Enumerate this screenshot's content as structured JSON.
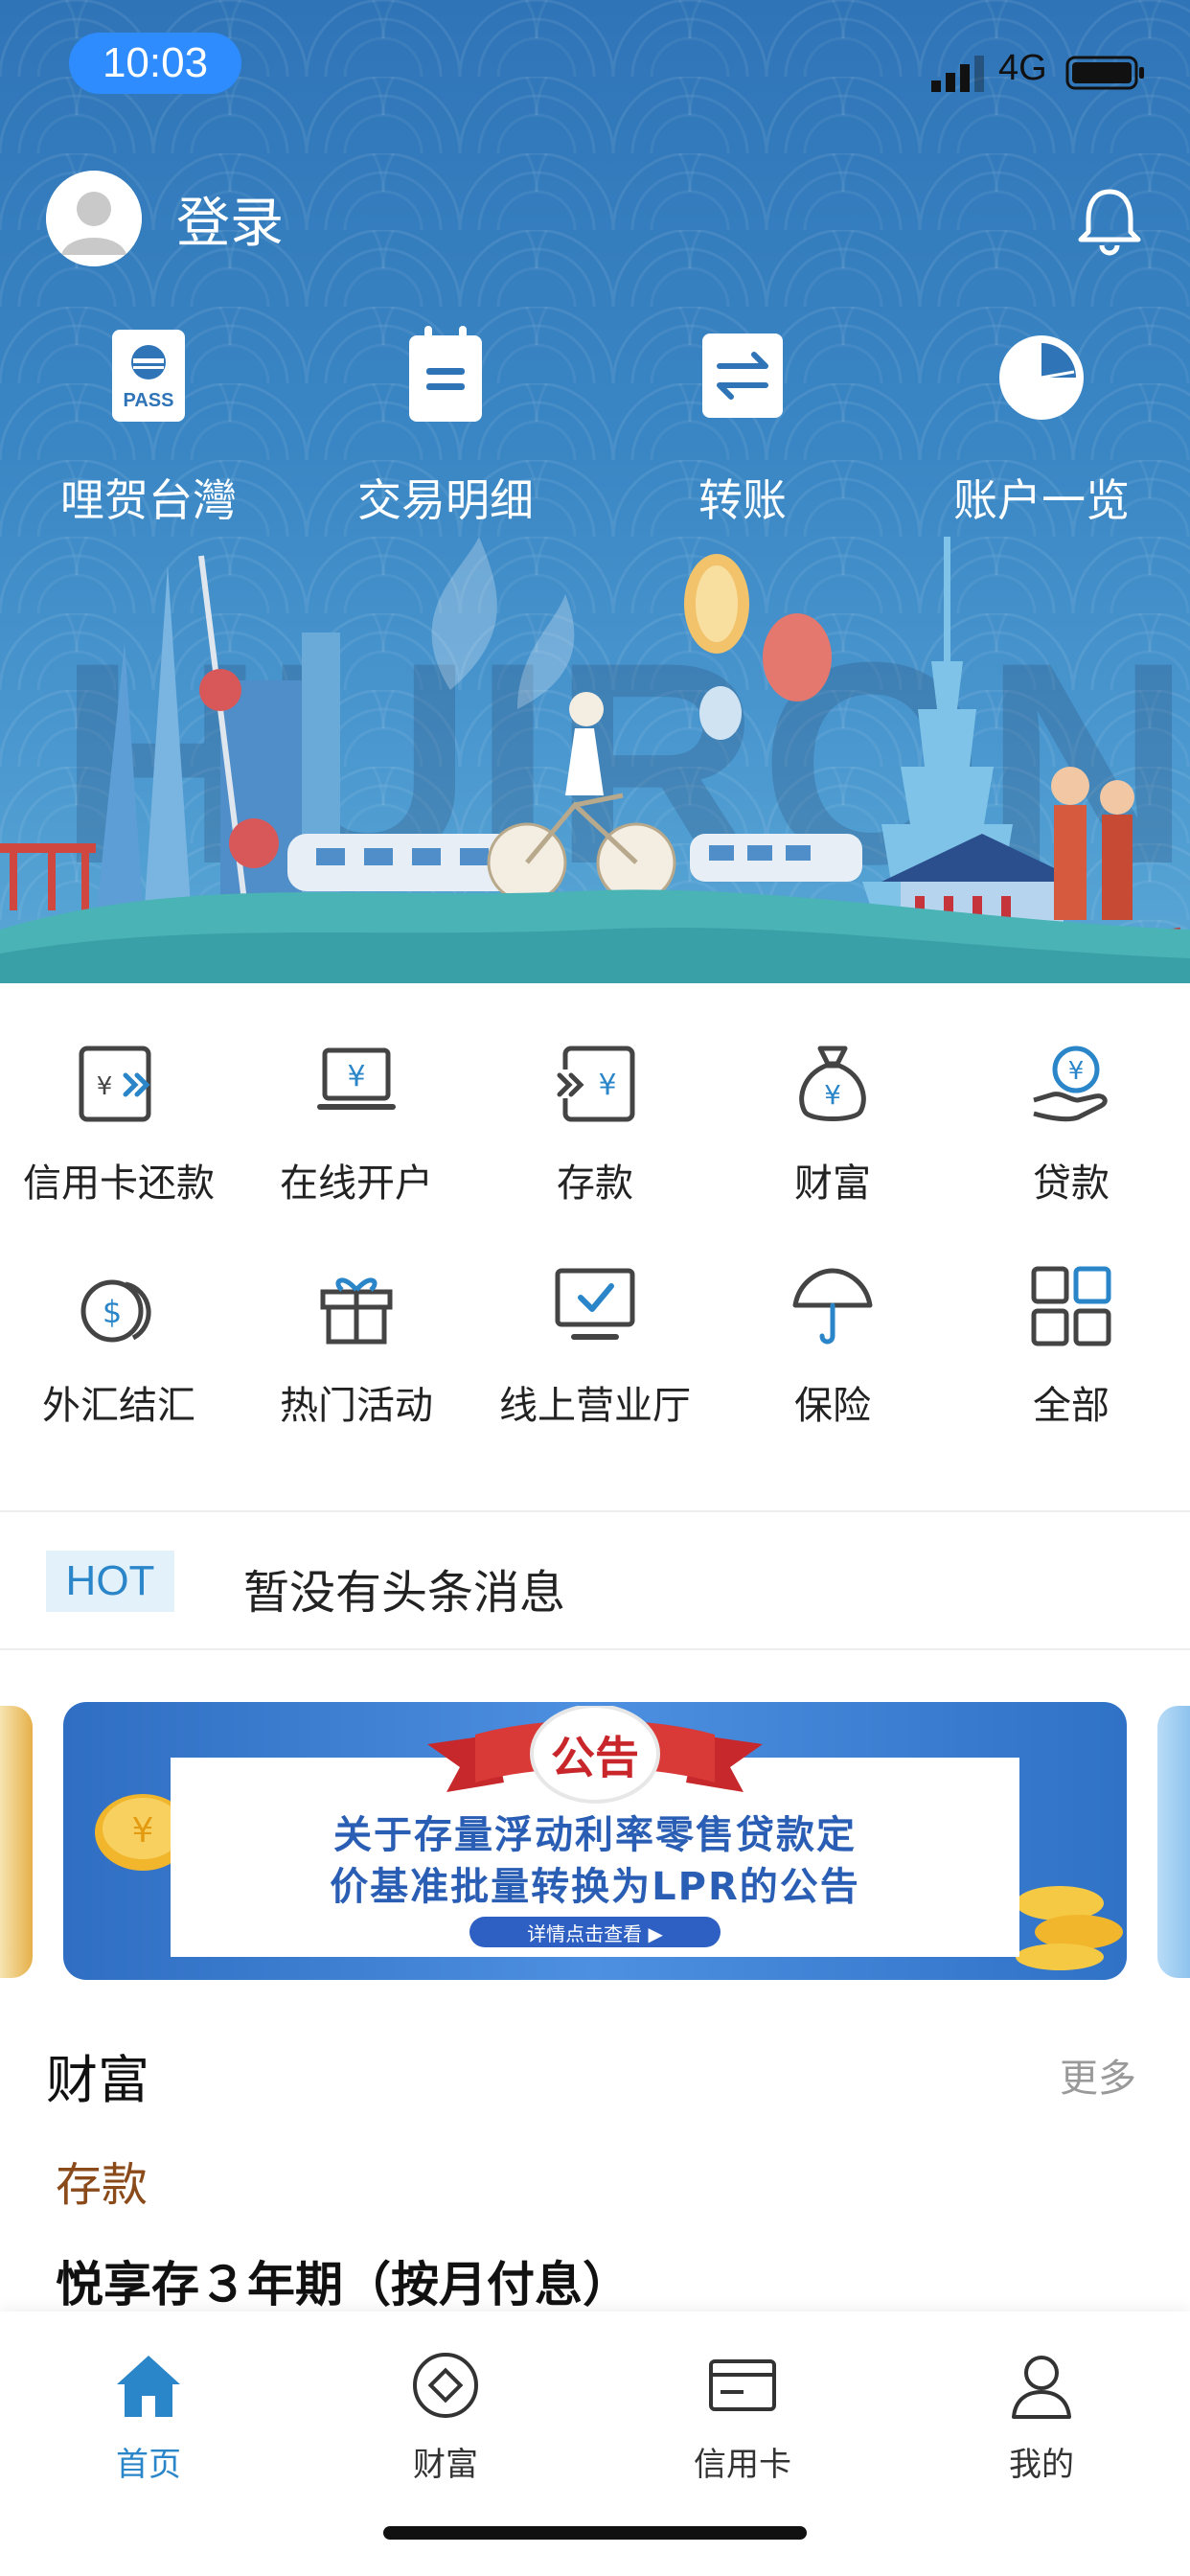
{
  "status_bar": {
    "time": "10:03",
    "network": "4G"
  },
  "header": {
    "login_label": "登录"
  },
  "quick_actions": [
    {
      "label": "哩贺台灣",
      "icon": "pass-icon"
    },
    {
      "label": "交易明细",
      "icon": "notepad-icon"
    },
    {
      "label": "转账",
      "icon": "transfer-icon"
    },
    {
      "label": "账户一览",
      "icon": "pie-chart-icon"
    }
  ],
  "services": [
    {
      "label": "信用卡还款",
      "icon": "card-repay-icon"
    },
    {
      "label": "在线开户",
      "icon": "laptop-yen-icon"
    },
    {
      "label": "存款",
      "icon": "deposit-icon"
    },
    {
      "label": "财富",
      "icon": "money-bag-icon"
    },
    {
      "label": "贷款",
      "icon": "hand-yen-icon"
    },
    {
      "label": "外汇结汇",
      "icon": "coins-icon"
    },
    {
      "label": "热门活动",
      "icon": "gift-icon"
    },
    {
      "label": "线上营业厅",
      "icon": "monitor-check-icon"
    },
    {
      "label": "保险",
      "icon": "umbrella-icon"
    },
    {
      "label": "全部",
      "icon": "grid-icon"
    }
  ],
  "hot": {
    "badge": "HOT",
    "message": "暂没有头条消息"
  },
  "banner": {
    "ribbon": "公告",
    "title_line1": "关于存量浮动利率零售贷款定",
    "title_line2": "价基准批量转换为LPR的公告",
    "cta": "详情点击查看 ▶"
  },
  "wealth": {
    "title": "财富",
    "more": "更多",
    "category": "存款",
    "product": "悦享存３年期（按月付息）"
  },
  "tabbar": [
    {
      "label": "首页",
      "icon": "home-icon",
      "active": true
    },
    {
      "label": "财富",
      "icon": "diamond-icon",
      "active": false
    },
    {
      "label": "信用卡",
      "icon": "credit-card-icon",
      "active": false
    },
    {
      "label": "我的",
      "icon": "person-icon",
      "active": false
    }
  ],
  "colors": {
    "accent": "#2a86c8",
    "hero": "#3a86c4",
    "category": "#8a4a1a"
  }
}
